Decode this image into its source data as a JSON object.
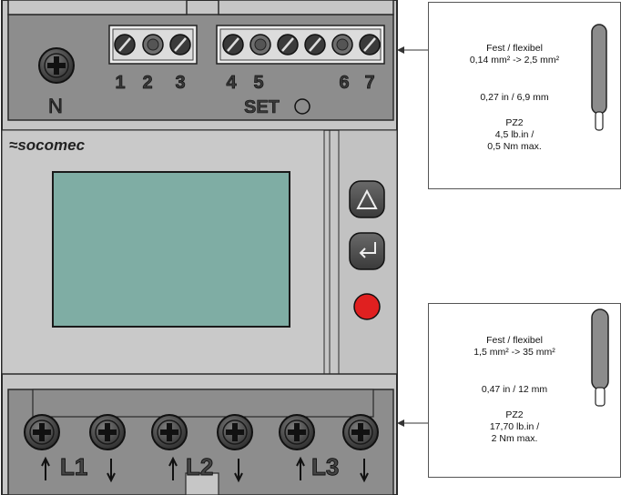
{
  "device": {
    "brand": "socomec",
    "top_terminals": {
      "neutral": "N",
      "numbers": [
        "1",
        "2",
        "3",
        "4",
        "5",
        "6",
        "7"
      ],
      "set_label": "SET"
    },
    "bottom_terminals": {
      "phases": [
        "L1",
        "L2",
        "L3"
      ]
    },
    "buttons": [
      "up-arrow-button",
      "enter-button",
      "red-button"
    ],
    "colors": {
      "body": "#c6c6c6",
      "terminal_block": "#8a8a8a",
      "screen": "#7fada4",
      "red_button": "#e02020"
    }
  },
  "callout_top": {
    "line1": "Fest / flexibel",
    "line2": "0,14 mm² -> 2,5 mm²",
    "line3": "0,27 in / 6,9 mm",
    "line4": "PZ2",
    "line5": "4,5 lb.in /",
    "line6": "0,5 Nm max."
  },
  "callout_bottom": {
    "line1": "Fest / flexibel",
    "line2": "1,5 mm² -> 35 mm²",
    "line3": "0,47 in / 12 mm",
    "line4": "PZ2",
    "line5": "17,70 lb.in /",
    "line6": "2 Nm max."
  }
}
